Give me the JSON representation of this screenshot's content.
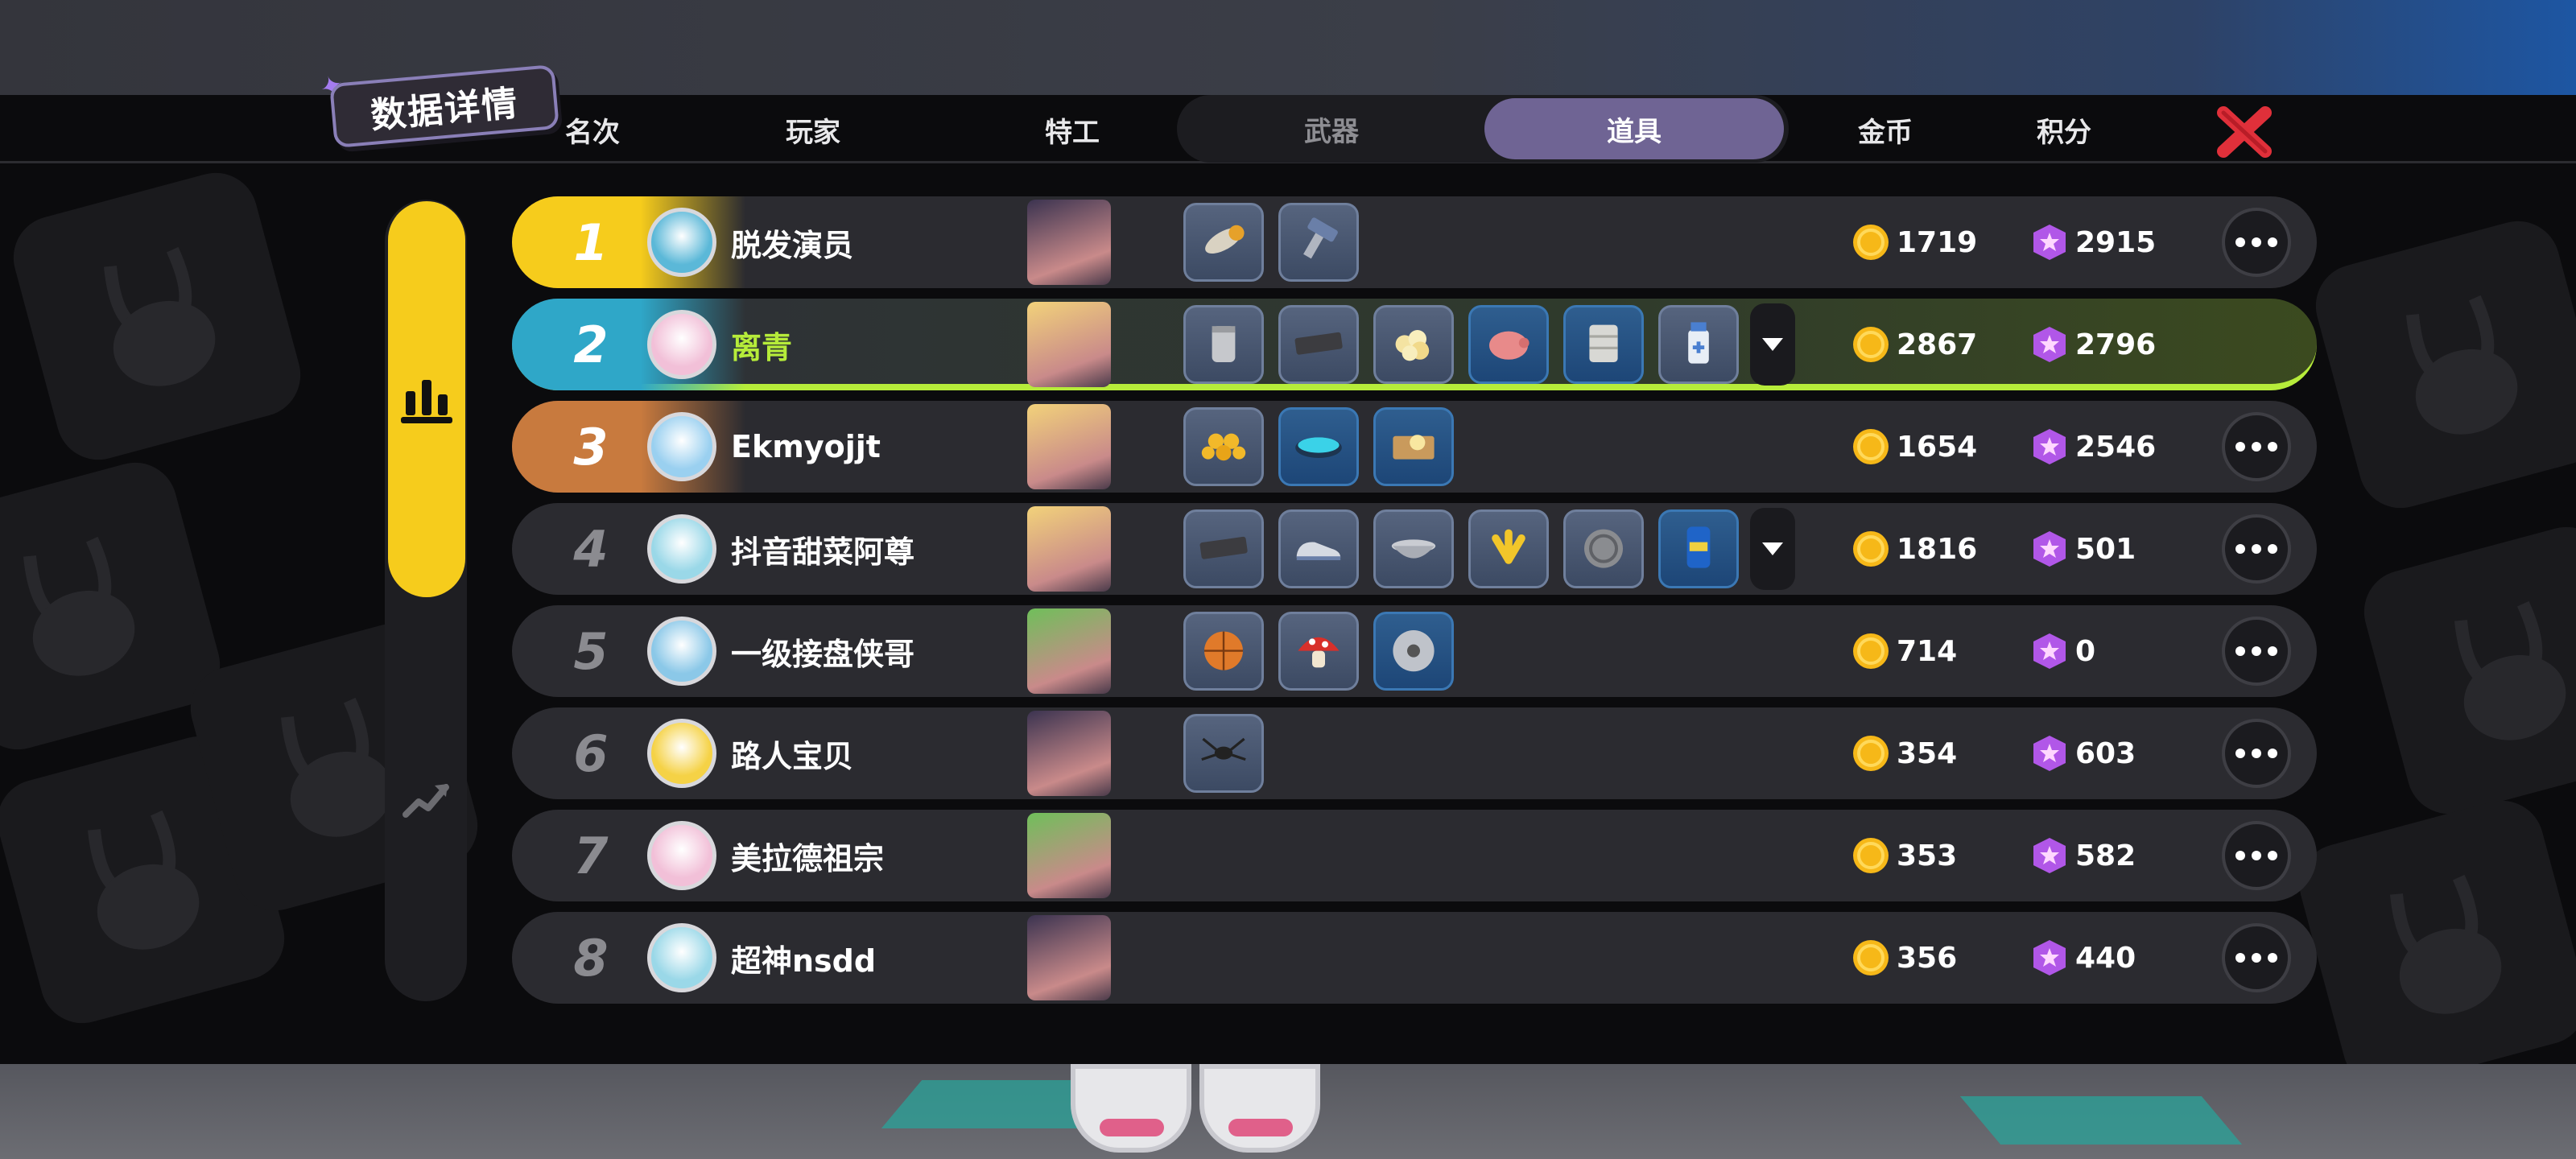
{
  "header": {
    "title": "数据详情",
    "columns": {
      "rank": "名次",
      "player": "玩家",
      "agent": "特工",
      "coins": "金币",
      "score": "积分"
    },
    "tabs": [
      {
        "label": "武器",
        "active": false
      },
      {
        "label": "道具",
        "active": true
      }
    ]
  },
  "icons": {
    "close": "close-x-icon",
    "stats_tab": "bar-chart-icon",
    "trend_tab": "trend-icon",
    "coin": "gold-coin-icon",
    "score": "purple-star-icon",
    "more": "more-dots-icon",
    "expand": "chevron-down-icon"
  },
  "colors": {
    "rank1": "#f6cc1c",
    "rank2": "#2fa7c8",
    "rank3": "#c87a3e",
    "self_highlight": "#b6ec3a",
    "active_tab": "#6f6494",
    "close": "#e0303a"
  },
  "rows": [
    {
      "rank": "1",
      "name": "脱发演员",
      "coins": "1719",
      "score": "2915",
      "items": [
        "bullet",
        "hammer"
      ]
    },
    {
      "rank": "2",
      "name": "离青",
      "coins": "2867",
      "score": "2796",
      "items": [
        "can",
        "brick",
        "popcorn",
        "piggy-bank",
        "bandage",
        "medicine-bottle"
      ],
      "self": true
    },
    {
      "rank": "3",
      "name": "Ekmyojjt",
      "coins": "1654",
      "score": "2546",
      "items": [
        "honeycomb",
        "trampoline",
        "book"
      ]
    },
    {
      "rank": "4",
      "name": "抖音甜菜阿尊",
      "coins": "1816",
      "score": "501",
      "items": [
        "brick",
        "sneaker",
        "pot",
        "banana-peel",
        "manhole-cover",
        "energy-can"
      ]
    },
    {
      "rank": "5",
      "name": "一级接盘侠哥",
      "coins": "714",
      "score": "0",
      "items": [
        "basketball",
        "mushroom",
        "saw-blade"
      ]
    },
    {
      "rank": "6",
      "name": "路人宝贝",
      "coins": "354",
      "score": "603",
      "items": [
        "spider"
      ]
    },
    {
      "rank": "7",
      "name": "美拉德祖宗",
      "coins": "353",
      "score": "582",
      "items": []
    },
    {
      "rank": "8",
      "name": "超神nsdd",
      "coins": "356",
      "score": "440",
      "items": []
    }
  ]
}
